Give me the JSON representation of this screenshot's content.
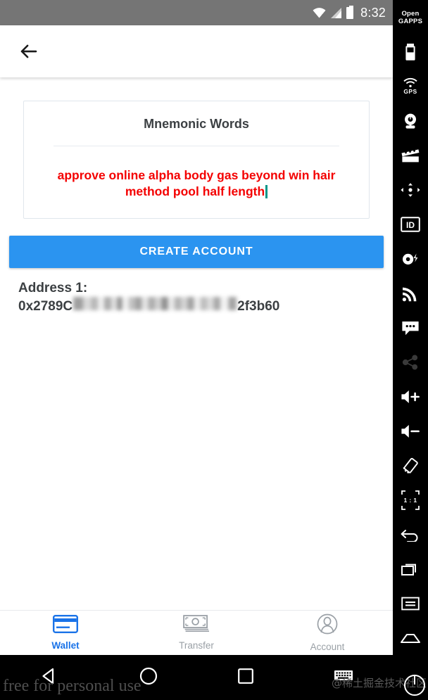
{
  "status_bar": {
    "time": "8:32",
    "icons": [
      "wifi-off-icon",
      "signal-icon",
      "battery-icon"
    ],
    "background": "#757575"
  },
  "app_bar": {
    "back_icon": "back-arrow-icon"
  },
  "mnemonic_card": {
    "title": "Mnemonic Words",
    "words": "approve online alpha body gas beyond win hair method pool half length",
    "text_color": "#f40000",
    "caret_color": "#009688"
  },
  "create_button": {
    "label": "CREATE ACCOUNT",
    "color": "#2b94f0"
  },
  "address": {
    "label": "Address 1:",
    "prefix": "0x2789C",
    "suffix": "2f3b60",
    "redacted": true
  },
  "bottom_nav": {
    "items": [
      {
        "label": "Wallet",
        "icon": "credit-card-icon",
        "active": true
      },
      {
        "label": "Transfer",
        "icon": "banknote-icon",
        "active": false
      },
      {
        "label": "Account",
        "icon": "person-circle-icon",
        "active": false
      }
    ],
    "active_color": "#1a73e8",
    "inactive_color": "#9aa0a6"
  },
  "android_nav": {
    "buttons": [
      "back-triangle-icon",
      "home-circle-icon",
      "recents-square-icon",
      "keyboard-icon"
    ]
  },
  "emulator_toolbar": {
    "gapps_line1": "Open",
    "gapps_line2": "GAPPS",
    "gps_label": "GPS",
    "ratio_label": "1 : 1",
    "id_label": "ID",
    "items": [
      "open-gapps-icon",
      "battery-icon",
      "gps-icon",
      "webcam-icon",
      "movie-clapper-icon",
      "dpad-icon",
      "id-badge-icon",
      "power-flash-icon",
      "cellular-icon",
      "sms-bubble-icon",
      "share-icon",
      "volume-up-icon",
      "volume-down-icon",
      "rotate-icon",
      "zoom-ratio-icon",
      "back-icon",
      "overview-icon",
      "menu-icon",
      "home-icon"
    ]
  },
  "watermarks": {
    "left": "free for personal use",
    "right": "@稀土掘金技术社区"
  }
}
